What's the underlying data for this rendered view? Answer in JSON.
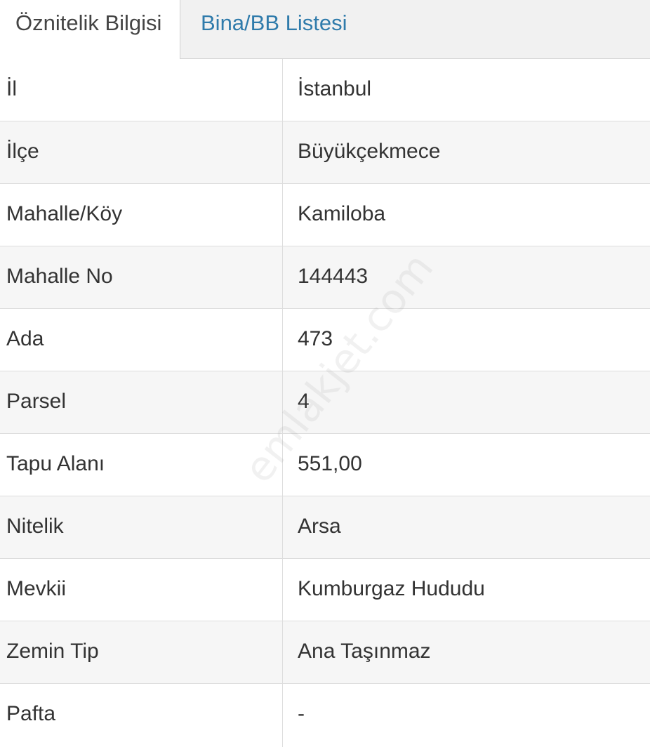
{
  "tabs": {
    "active_label": "Öznitelik Bilgisi",
    "inactive_label": "Bina/BB Listesi"
  },
  "rows": [
    {
      "key": "İl",
      "value": "İstanbul"
    },
    {
      "key": "İlçe",
      "value": "Büyükçekmece"
    },
    {
      "key": "Mahalle/Köy",
      "value": "Kamiloba"
    },
    {
      "key": "Mahalle No",
      "value": "144443"
    },
    {
      "key": "Ada",
      "value": "473"
    },
    {
      "key": "Parsel",
      "value": "4"
    },
    {
      "key": "Tapu Alanı",
      "value": "551,00"
    },
    {
      "key": "Nitelik",
      "value": "Arsa"
    },
    {
      "key": "Mevkii",
      "value": "Kumburgaz Hududu"
    },
    {
      "key": "Zemin Tip",
      "value": "Ana Taşınmaz"
    },
    {
      "key": "Pafta",
      "value": "-"
    }
  ],
  "watermark": "emlakjet.com",
  "colors": {
    "tab_link": "#2f7bab",
    "stripe": "#f6f6f6",
    "border": "#dddddd"
  }
}
